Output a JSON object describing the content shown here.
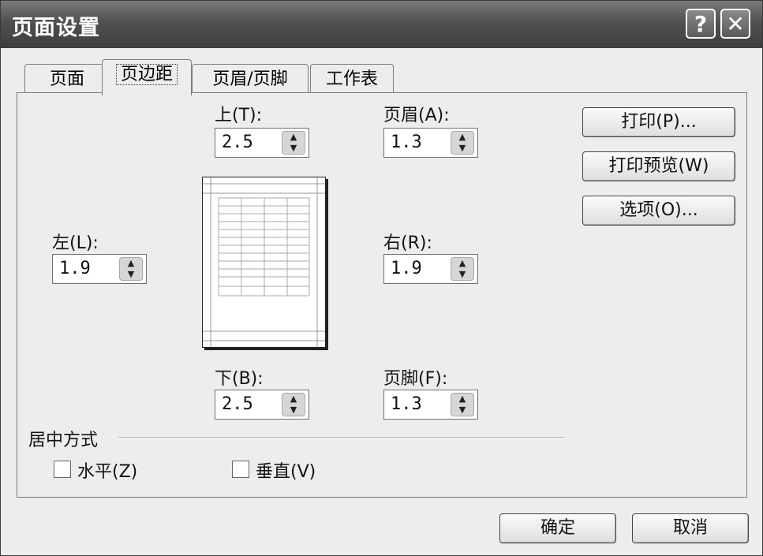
{
  "dialog": {
    "title": "页面设置",
    "help_glyph": "?",
    "close_glyph": "✕"
  },
  "tabs": [
    "页面",
    "页边距",
    "页眉/页脚",
    "工作表"
  ],
  "active_tab": "页边距",
  "margins": {
    "top": {
      "label": "上(T):",
      "value": "2.5"
    },
    "header": {
      "label": "页眉(A):",
      "value": "1.3"
    },
    "left": {
      "label": "左(L):",
      "value": "1.9"
    },
    "right": {
      "label": "右(R):",
      "value": "1.9"
    },
    "bottom": {
      "label": "下(B):",
      "value": "2.5"
    },
    "footer": {
      "label": "页脚(F):",
      "value": "1.3"
    }
  },
  "side_buttons": {
    "print": "打印(P)...",
    "print_preview": "打印预览(W)",
    "options": "选项(O)..."
  },
  "centering": {
    "title": "居中方式",
    "horizontal": {
      "label": "水平(Z)",
      "checked": false
    },
    "vertical": {
      "label": "垂直(V)",
      "checked": false
    }
  },
  "footer_buttons": {
    "ok": "确定",
    "cancel": "取消"
  },
  "icons": {
    "spin_up": "up-arrow-icon",
    "spin_down": "down-arrow-icon"
  }
}
